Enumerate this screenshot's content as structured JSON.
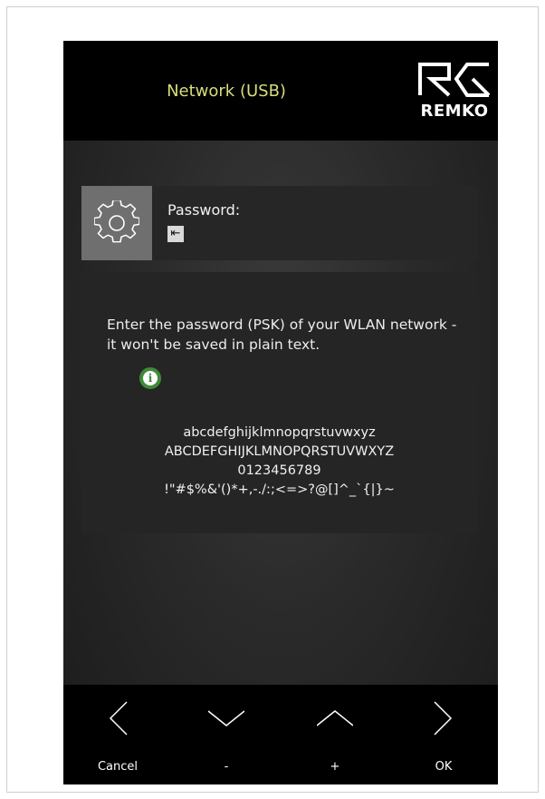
{
  "header": {
    "title": "Network (USB)",
    "logo_text": "REMKO"
  },
  "parameter": {
    "icon": "gear-icon",
    "label": "Password:",
    "cursor_glyph": "⇤"
  },
  "info": {
    "text": "Enter the password (PSK) of your WLAN network - it won't be saved in plain text.",
    "badge_icon": "info-icon",
    "badge_glyph": "i",
    "charsets": [
      "abcdefghijklmnopqrstuvwxyz",
      "ABCDEFGHIJKLMNOPQRSTUVWXYZ",
      "0123456789",
      "!\"#$%&'()*+,-./:;<=>?@[]^_`{|}~"
    ]
  },
  "footer": {
    "buttons": [
      {
        "label": "Cancel",
        "icon": "chevron-left-icon"
      },
      {
        "label": "-",
        "icon": "chevron-down-icon"
      },
      {
        "label": "+",
        "icon": "chevron-up-icon"
      },
      {
        "label": "OK",
        "icon": "chevron-right-icon"
      }
    ]
  },
  "colors": {
    "title": "#d8dd7c",
    "header_bg": "#000000",
    "panel_bg": "#252525",
    "icon_bg": "#6f6f6f",
    "info_badge": "#3f8b38"
  }
}
